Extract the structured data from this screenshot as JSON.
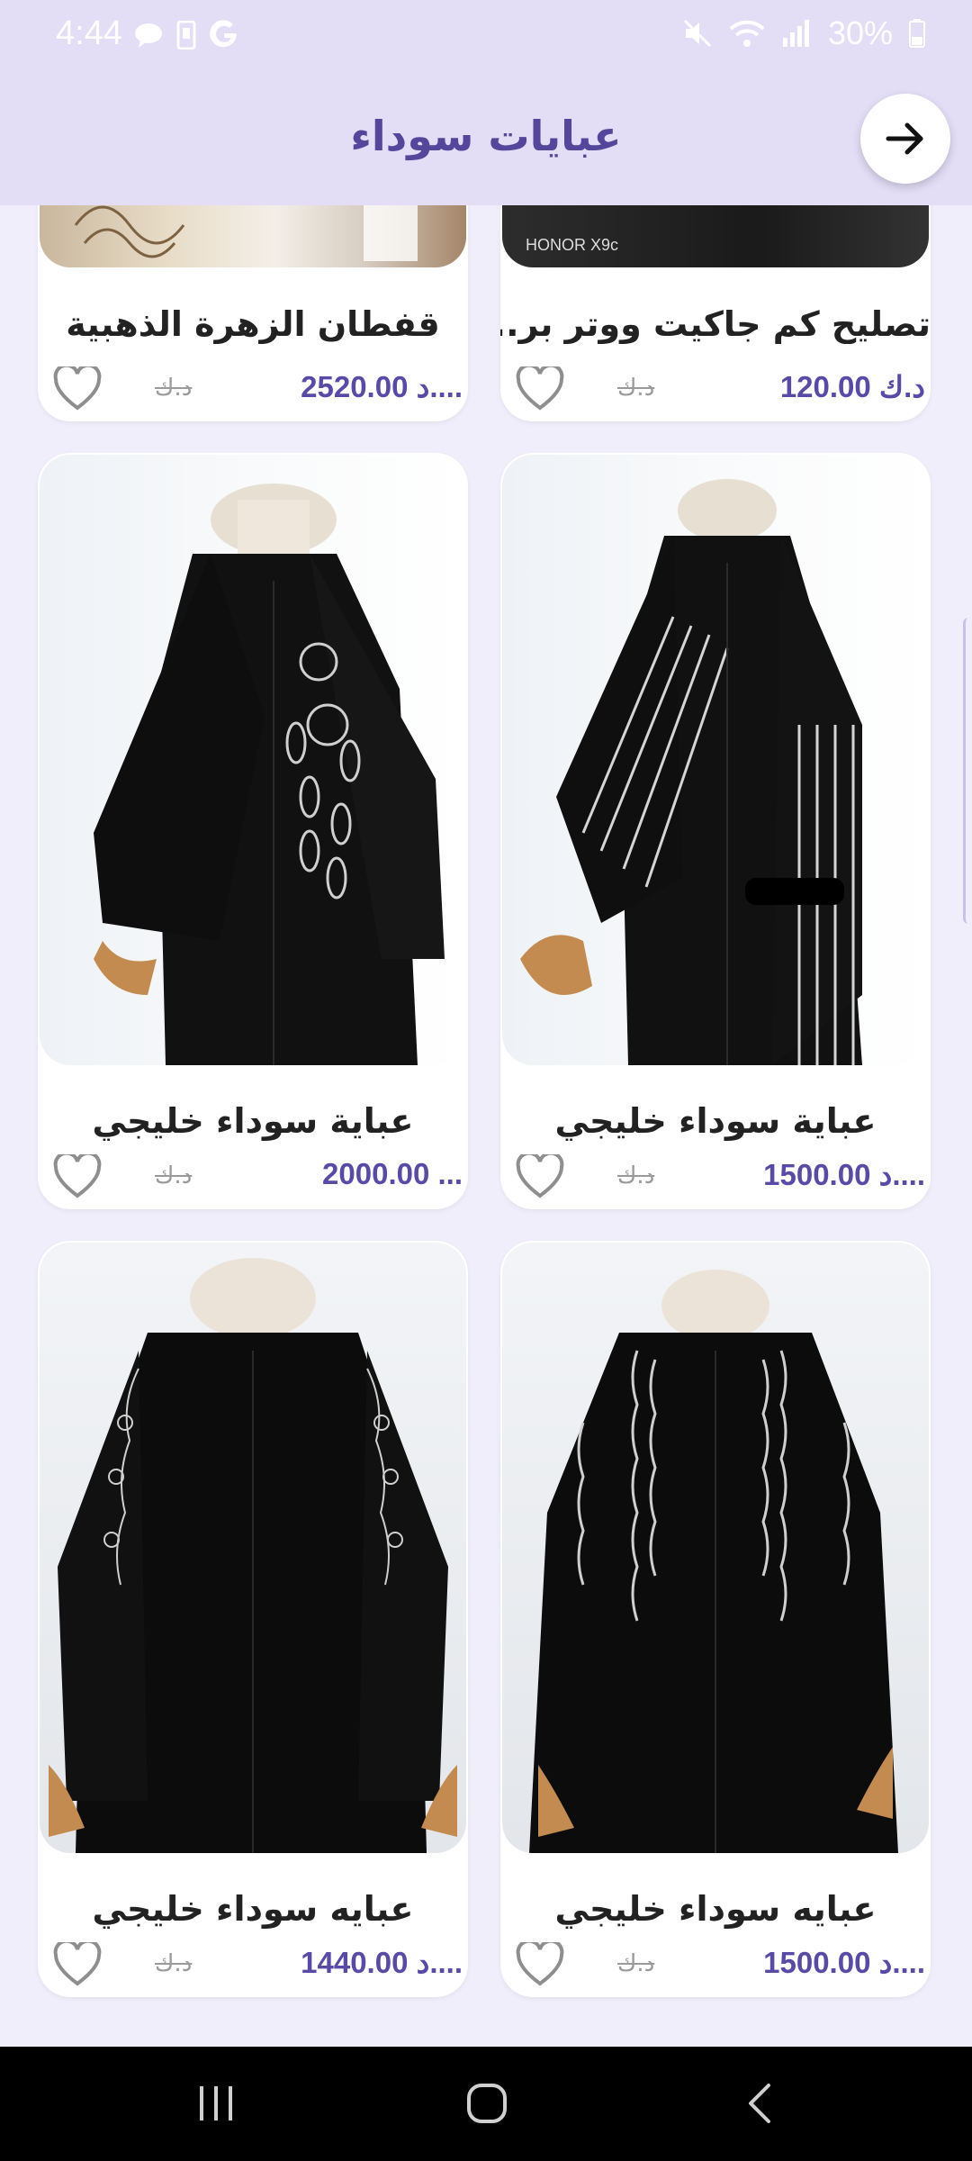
{
  "status_bar": {
    "time": "4:44",
    "battery": "30%"
  },
  "header": {
    "title": "عبايات سوداء"
  },
  "products": [
    {
      "name": "قفطان الزهرة الذهبية",
      "price": "2520.00 د....",
      "old_price": "د.ك"
    },
    {
      "name": "تصليح كم جاكيت ووتر بر...",
      "price": "120.00 د.ك",
      "old_price": "د.ك",
      "image_label": "HONOR X9c"
    },
    {
      "name": "عباية سوداء خليجي",
      "price": "2000.00 ...",
      "old_price": "د.ك"
    },
    {
      "name": "عباية سوداء خليجي",
      "price": "1500.00 د....",
      "old_price": "د.ك"
    },
    {
      "name": "عبايه سوداء خليجي",
      "price": "1440.00 د....",
      "old_price": "د.ك"
    },
    {
      "name": "عبايه سوداء خليجي",
      "price": "1500.00 د....",
      "old_price": "د.ك"
    }
  ],
  "colors": {
    "accent": "#5a4aa8",
    "header_bg": "#e3ddf6",
    "page_bg": "#f1eefb"
  }
}
